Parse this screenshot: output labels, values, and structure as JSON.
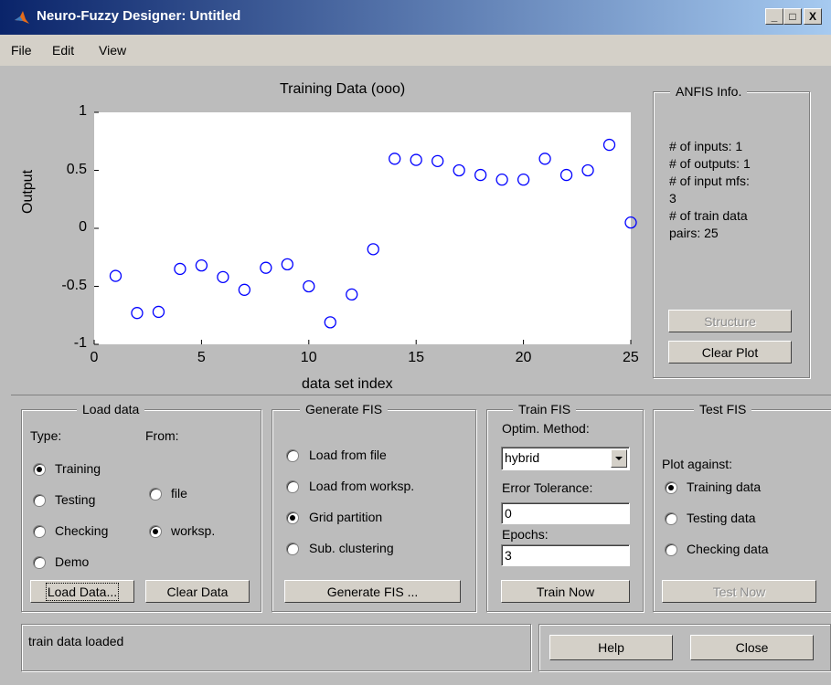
{
  "window": {
    "title": "Neuro-Fuzzy Designer: Untitled",
    "caption_buttons": [
      "_",
      "□",
      "X"
    ]
  },
  "menu": [
    "File",
    "Edit",
    "View"
  ],
  "chart_data": {
    "type": "scatter",
    "title": "Training Data (ooo)",
    "xlabel": "data set index",
    "ylabel": "Output",
    "xlim": [
      0,
      25
    ],
    "ylim": [
      -1,
      1
    ],
    "xticks": [
      "0",
      "5",
      "10",
      "15",
      "20",
      "25"
    ],
    "yticks": [
      "1",
      "0.5",
      "0",
      "-0.5",
      "-1"
    ],
    "marker": "circle-open",
    "color": "#0000ff",
    "x": [
      1,
      2,
      3,
      4,
      5,
      6,
      7,
      8,
      9,
      10,
      11,
      12,
      13,
      14,
      15,
      16,
      17,
      18,
      19,
      20,
      21,
      22,
      23,
      24,
      25
    ],
    "y": [
      -0.41,
      -0.73,
      -0.72,
      -0.35,
      -0.32,
      -0.42,
      -0.53,
      -0.34,
      -0.31,
      -0.5,
      -0.81,
      -0.57,
      -0.18,
      0.6,
      0.59,
      0.58,
      0.5,
      0.46,
      0.42,
      0.42,
      0.6,
      0.46,
      0.5,
      0.72,
      0.05
    ]
  },
  "anfis_info": {
    "title": "ANFIS Info.",
    "lines": [
      "# of inputs: 1",
      "# of outputs: 1",
      "# of input mfs:",
      "3",
      "# of train data",
      "pairs: 25"
    ],
    "structure_button": "Structure",
    "clear_plot_button": "Clear Plot"
  },
  "load_data": {
    "title": "Load data",
    "type_label": "Type:",
    "from_label": "From:",
    "types": [
      {
        "label": "Training",
        "selected": true
      },
      {
        "label": "Testing",
        "selected": false
      },
      {
        "label": "Checking",
        "selected": false
      },
      {
        "label": "Demo",
        "selected": false
      }
    ],
    "sources": [
      {
        "label": "file",
        "selected": false
      },
      {
        "label": "worksp.",
        "selected": true
      }
    ],
    "load_button": "Load Data...",
    "clear_button": "Clear Data"
  },
  "generate_fis": {
    "title": "Generate FIS",
    "options": [
      {
        "label": "Load from file",
        "selected": false
      },
      {
        "label": "Load from worksp.",
        "selected": false
      },
      {
        "label": "Grid partition",
        "selected": true
      },
      {
        "label": "Sub. clustering",
        "selected": false
      }
    ],
    "button": "Generate FIS ..."
  },
  "train_fis": {
    "title": "Train FIS",
    "method_label": "Optim. Method:",
    "method_value": "hybrid",
    "tolerance_label": "Error Tolerance:",
    "tolerance_value": "0",
    "epochs_label": "Epochs:",
    "epochs_value": "3",
    "button": "Train Now"
  },
  "test_fis": {
    "title": "Test FIS",
    "plot_against_label": "Plot against:",
    "options": [
      {
        "label": "Training data",
        "selected": true
      },
      {
        "label": "Testing data",
        "selected": false
      },
      {
        "label": "Checking data",
        "selected": false
      }
    ],
    "button": "Test Now"
  },
  "status": {
    "message": "train data loaded"
  },
  "footer": {
    "help_button": "Help",
    "close_button": "Close"
  }
}
